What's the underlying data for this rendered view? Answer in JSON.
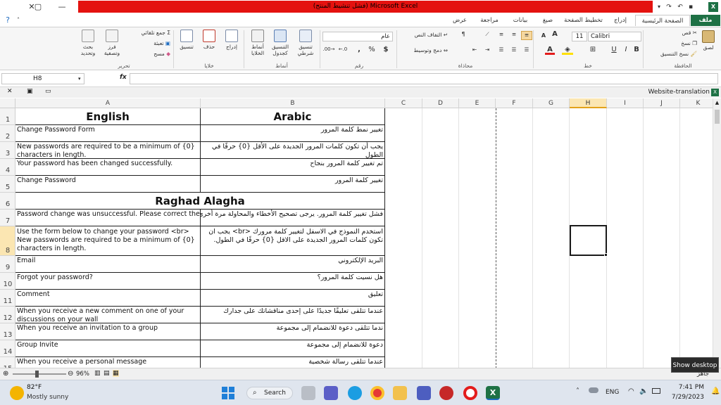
{
  "window": {
    "title": "Microsoft Excel (فشل تنشيط المنتج)"
  },
  "ribbon_tabs": [
    {
      "label": "ملف"
    },
    {
      "label": "الصفحة الرئيسية"
    },
    {
      "label": "إدراج"
    },
    {
      "label": "تخطيط الصفحة"
    },
    {
      "label": "صيغ"
    },
    {
      "label": "بيانات"
    },
    {
      "label": "مراجعة"
    },
    {
      "label": "عرض"
    }
  ],
  "ribbon": {
    "clipboard": {
      "paste": "لصق",
      "cut": "قص",
      "copy": "نسخ",
      "format_painter": "نسخ التنسيق",
      "label": "الحافظة"
    },
    "font": {
      "name": "Calibri",
      "size": "11",
      "bold": "B",
      "italic": "I",
      "underline": "U",
      "label": "خط",
      "grow": "A",
      "shrink": "A"
    },
    "alignment": {
      "wrap": "التفاف النص",
      "merge": "دمج وتوسيط",
      "label": "محاذاة"
    },
    "number": {
      "format": "عام",
      "currency": "$",
      "percent": "%",
      "comma": ",",
      "label": "رقم"
    },
    "styles": {
      "conditional": "تنسيق شرطي",
      "as_table": "التنسيق كجدول",
      "cell_styles": "أنماط الخلايا",
      "label": "أنماط"
    },
    "cells": {
      "insert": "إدراج",
      "delete": "حذف",
      "format": "تنسيق",
      "label": "خلايا"
    },
    "editing": {
      "autosum": "جمع تلقائي",
      "fill": "تعبئة",
      "clear": "مسح",
      "sort": "فرز وتصفية",
      "find": "بحث وتحديد",
      "label": "تحرير"
    }
  },
  "formula_bar": {
    "name_box": "H8",
    "fx": "fx",
    "value": ""
  },
  "workbook": {
    "name": "Website-translation"
  },
  "columns": [
    "A",
    "B",
    "C",
    "D",
    "E",
    "F",
    "G",
    "H",
    "I",
    "J",
    "K"
  ],
  "selected_column": "H",
  "selected_row": "8",
  "rows": [
    {
      "num": "1",
      "a": "English",
      "b": "Arabic"
    },
    {
      "num": "2",
      "a": "Change Password Form",
      "b": "تغيير نمط كلمة المرور"
    },
    {
      "num": "3",
      "a": "New passwords are required to be a minimum of {0} characters in length.",
      "b": "يجب أن تكون كلمات المرور الجديدة على الأقل {0} حرفًا في الطول"
    },
    {
      "num": "4",
      "a": "Your password has been changed successfully.",
      "b": "تم تغيير كلمة المرور بنجاح"
    },
    {
      "num": "5",
      "a": "Change Password",
      "b": "تغيير كلمة المرور"
    },
    {
      "num": "6",
      "merged": "Raghad Alagha"
    },
    {
      "num": "7",
      "a": "Password change was unsuccessful. Please correct the errors and try again.",
      "b": "فشل تغيير كلمة المرور. يرجى تصحيح الأخطاء والمحاولة مرة أخرى"
    },
    {
      "num": "8",
      "a": "Use the form below to change your password <br> New passwords are required to be a minimum of {0} characters in length.",
      "b": "استخدم النموذج في الاسفل لتغيير كلمة مرورك <br> يجب ان تكون كلمات المرور الجديدة على الاقل {0} حرفًا في الطول."
    },
    {
      "num": "9",
      "a": "Email",
      "b": "البريد الإلكتروني"
    },
    {
      "num": "10",
      "a": "Forgot your password?",
      "b": "هل نسيت كلمة المرور؟"
    },
    {
      "num": "11",
      "a": "Comment",
      "b": "تعليق"
    },
    {
      "num": "12",
      "a": "When you receive a new comment on one of your discussions on your wall",
      "b": "عندما تتلقى تعليقًا جديدًا على إحدى مناقشاتك على جدارك"
    },
    {
      "num": "13",
      "a": "When you receive an invitation to a group",
      "b": "ندما تتلقى دعوة للانضمام إلى مجموعة"
    },
    {
      "num": "14",
      "a": "Group Invite",
      "b": "دعوة للانضمام إلى مجموعة"
    },
    {
      "num": "15",
      "a": "When you receive a personal message",
      "b": "عندما تتلقى رسالة شخصية"
    }
  ],
  "status": {
    "zoom": "96%",
    "ready": "جاهز"
  },
  "tooltip": "Show desktop",
  "taskbar": {
    "weather_temp": "82°F",
    "weather_desc": "Mostly sunny",
    "search": "Search",
    "lang": "ENG",
    "time": "7:41 PM",
    "date": "7/29/2023"
  },
  "colors": {
    "title_red": "#e4120f",
    "excel_green": "#1e7145",
    "selection_header": "#fbe6b2"
  }
}
